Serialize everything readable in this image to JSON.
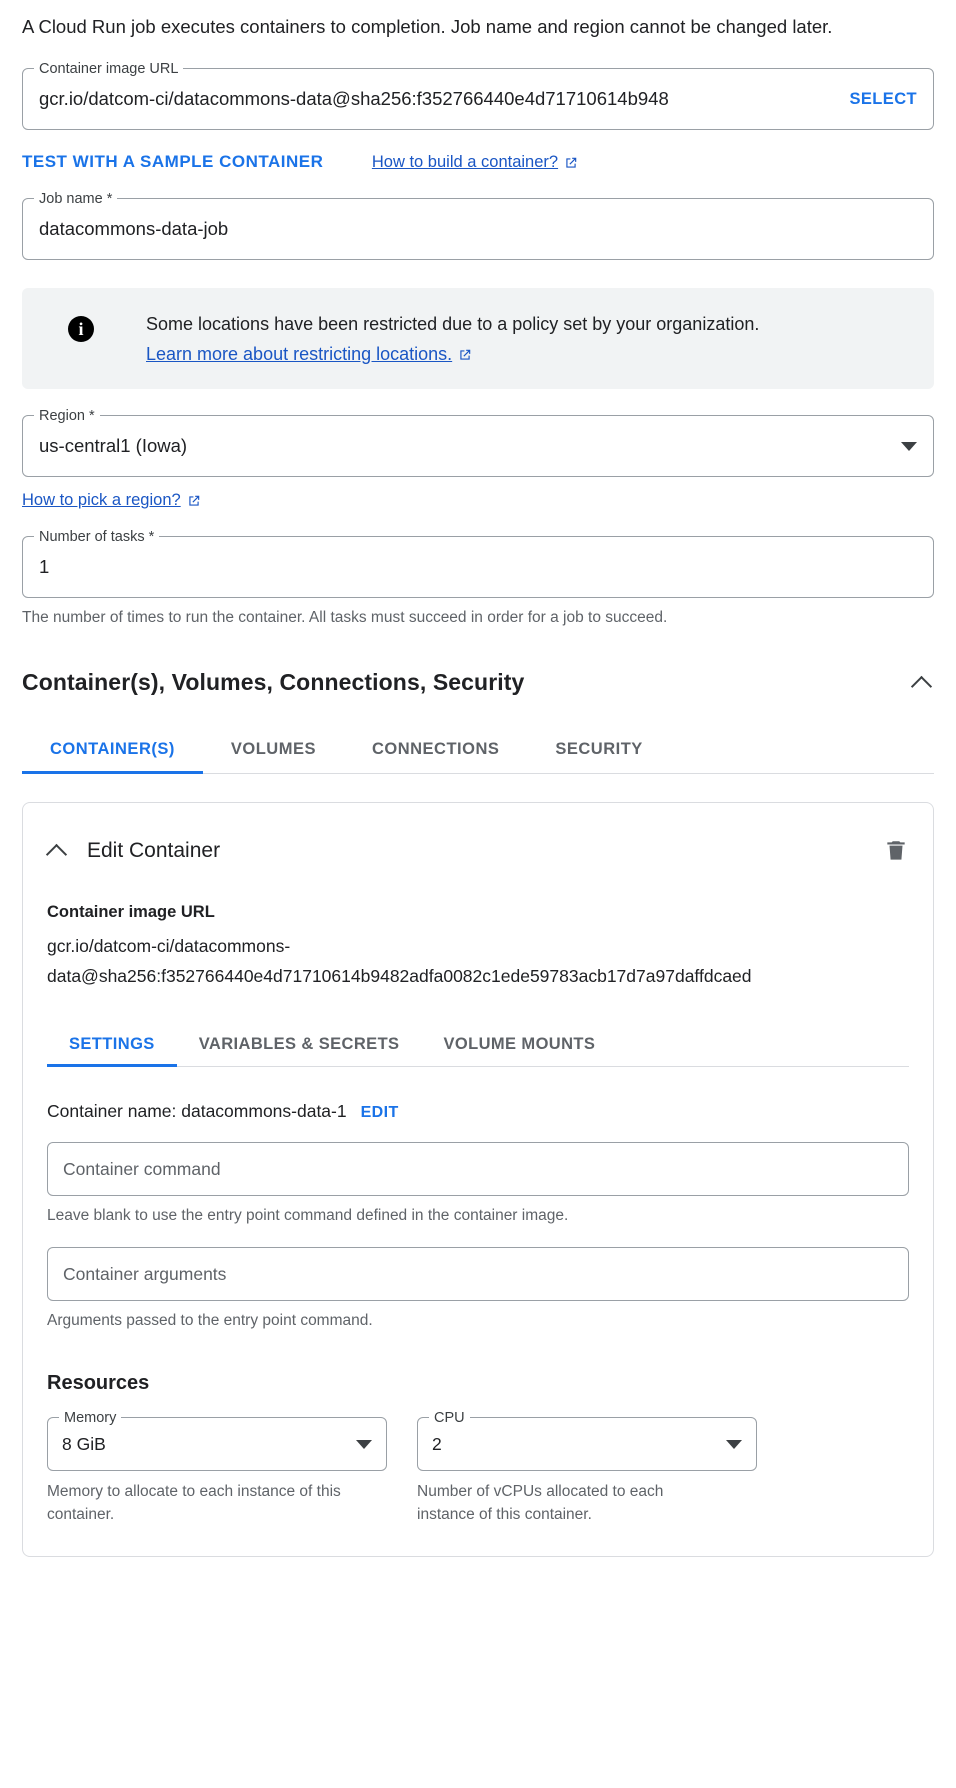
{
  "intro": {
    "text": "A Cloud Run job executes containers to completion. Job name and region cannot be changed later."
  },
  "colors": {
    "accent": "#1a73e8",
    "link": "#1a56c4",
    "banner_bg": "#f1f3f4",
    "border": "#9aa0a6",
    "muted_text": "#5f6368"
  },
  "image_url_field": {
    "label": "Container image URL",
    "value": "gcr.io/datcom-ci/datacommons-data@sha256:f352766440e4d71710614b948",
    "select_label": "SELECT"
  },
  "sample_container_button": {
    "label": "TEST WITH A SAMPLE CONTAINER"
  },
  "build_help_link": {
    "label": "How to build a container?"
  },
  "job_name_field": {
    "label": "Job name *",
    "value": "datacommons-data-job"
  },
  "policy_banner": {
    "icon": "info-icon",
    "text": "Some locations have been restricted due to a policy set by your organization.",
    "link_label": "Learn more about restricting locations."
  },
  "region_field": {
    "label": "Region *",
    "value": "us-central1 (Iowa)"
  },
  "region_help_link": {
    "label": "How to pick a region?"
  },
  "tasks_field": {
    "label": "Number of tasks *",
    "value": "1",
    "helper": "The number of times to run the container. All tasks must succeed in order for a job to succeed."
  },
  "section": {
    "title": "Container(s), Volumes, Connections, Security",
    "toggle_icon": "chevron-up-icon",
    "tabs": [
      {
        "label": "CONTAINER(S)",
        "active": true
      },
      {
        "label": "VOLUMES",
        "active": false
      },
      {
        "label": "CONNECTIONS",
        "active": false
      },
      {
        "label": "SECURITY",
        "active": false
      }
    ]
  },
  "container_card": {
    "toggle_icon": "chevron-up-icon",
    "title": "Edit Container",
    "delete_icon": "trash-icon",
    "image_url_label": "Container image URL",
    "image_url_line1": "gcr.io/datcom-ci/datacommons-",
    "image_url_line2": "data@sha256:f352766440e4d71710614b9482adfa0082c1ede59783acb17d7a97daffdcaed",
    "tabs": [
      {
        "label": "SETTINGS",
        "active": true
      },
      {
        "label": "VARIABLES & SECRETS",
        "active": false
      },
      {
        "label": "VOLUME MOUNTS",
        "active": false
      }
    ],
    "container_name_label": "Container name: datacommons-data-1",
    "container_name_edit": "EDIT",
    "command_field": {
      "placeholder": "Container command",
      "helper": "Leave blank to use the entry point command defined in the container image."
    },
    "arguments_field": {
      "placeholder": "Container arguments",
      "helper": "Arguments passed to the entry point command."
    },
    "resources": {
      "title": "Resources",
      "memory": {
        "label": "Memory",
        "value": "8 GiB",
        "helper": "Memory to allocate to each instance of this container."
      },
      "cpu": {
        "label": "CPU",
        "value": "2",
        "helper": "Number of vCPUs allocated to each instance of this container."
      }
    }
  }
}
